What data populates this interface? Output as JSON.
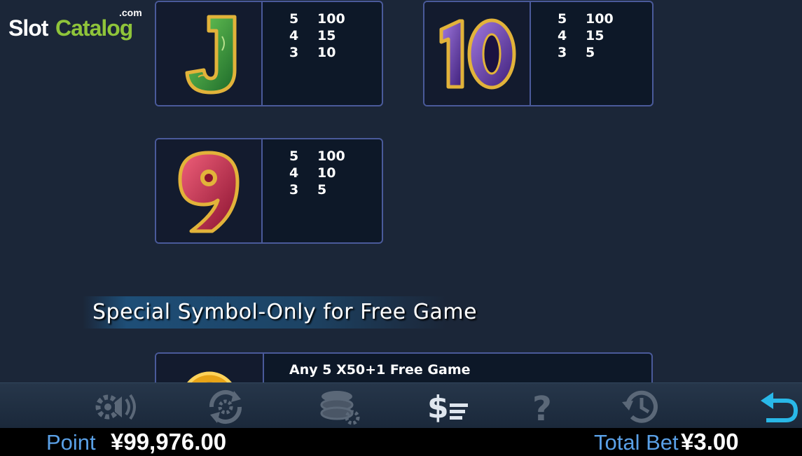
{
  "logo": {
    "slot": "Slot",
    "catalog": "Catalog",
    "com": ".com"
  },
  "paytable": [
    {
      "symbol": "J",
      "rows": [
        {
          "count": "5",
          "pay": "100"
        },
        {
          "count": "4",
          "pay": "15"
        },
        {
          "count": "3",
          "pay": "10"
        }
      ]
    },
    {
      "symbol": "10",
      "rows": [
        {
          "count": "5",
          "pay": "100"
        },
        {
          "count": "4",
          "pay": "15"
        },
        {
          "count": "3",
          "pay": "5"
        }
      ]
    },
    {
      "symbol": "9",
      "rows": [
        {
          "count": "5",
          "pay": "100"
        },
        {
          "count": "4",
          "pay": "10"
        },
        {
          "count": "3",
          "pay": "5"
        }
      ]
    }
  ],
  "special": {
    "title": "Special Symbol-Only for Free Game",
    "text": "Any 5  X50+1 Free Game"
  },
  "toolbar": [
    {
      "icon": "sound-settings-icon",
      "active": false
    },
    {
      "icon": "autoplay-icon",
      "active": false
    },
    {
      "icon": "chips-settings-icon",
      "active": false
    },
    {
      "icon": "paytable-icon",
      "active": true
    },
    {
      "icon": "help-icon",
      "active": false
    },
    {
      "icon": "history-icon",
      "active": false
    },
    {
      "icon": "back-icon",
      "active": true
    }
  ],
  "status": {
    "point_label": "Point",
    "point_value": "¥99,976.00",
    "bet_label": "Total Bet",
    "bet_value": "¥3.00"
  },
  "colors": {
    "accent": "#29b8e8",
    "label_blue": "#5aa0e6",
    "card_border": "#4a5a9a"
  }
}
